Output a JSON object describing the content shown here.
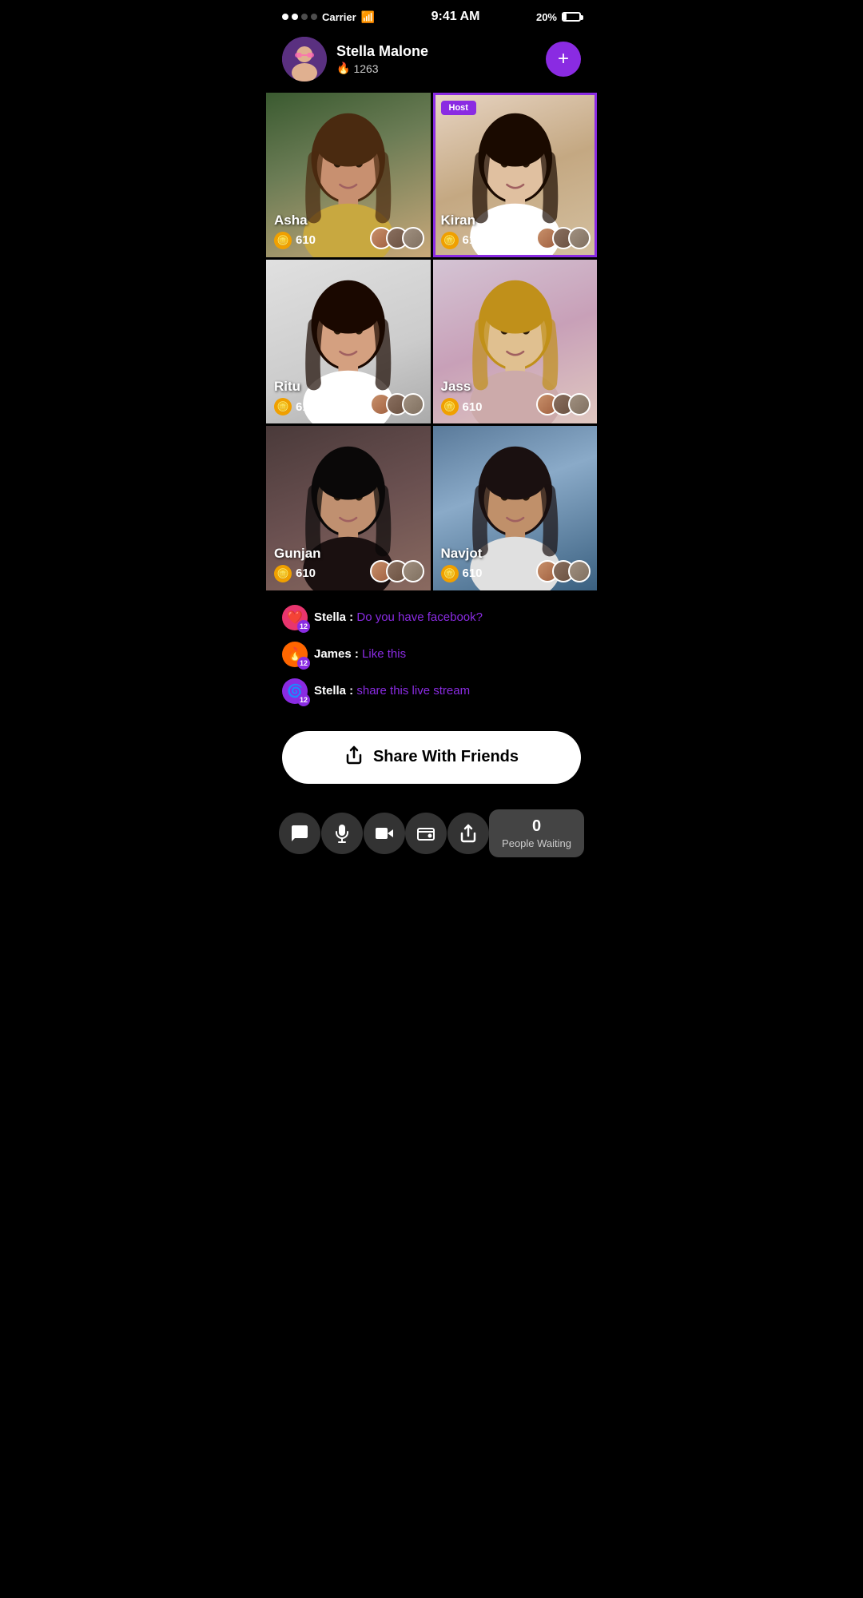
{
  "statusBar": {
    "carrier": "Carrier",
    "time": "9:41 AM",
    "battery": "20%"
  },
  "profile": {
    "name": "Stella Malone",
    "score": "1263",
    "addLabel": "+"
  },
  "videoGrid": [
    {
      "id": "asha",
      "name": "Asha",
      "coins": "610",
      "isHost": false,
      "bgClass": "bg-asha"
    },
    {
      "id": "kiran",
      "name": "Kiran",
      "coins": "610",
      "isHost": true,
      "hostLabel": "Host",
      "bgClass": "bg-kiran"
    },
    {
      "id": "ritu",
      "name": "Ritu",
      "coins": "610",
      "isHost": false,
      "bgClass": "bg-ritu"
    },
    {
      "id": "jass",
      "name": "Jass",
      "coins": "610",
      "isHost": false,
      "bgClass": "bg-jass"
    },
    {
      "id": "gunjan",
      "name": "Gunjan",
      "coins": "610",
      "isHost": false,
      "bgClass": "bg-gunjan"
    },
    {
      "id": "navjot",
      "name": "Navjot",
      "coins": "610",
      "isHost": false,
      "bgClass": "bg-navjot"
    }
  ],
  "chat": {
    "messages": [
      {
        "id": "msg1",
        "username": "Stella",
        "message": "Do you have facebook?",
        "avatarType": "heart",
        "badge": "12"
      },
      {
        "id": "msg2",
        "username": "James",
        "message": "Like this",
        "avatarType": "fire",
        "badge": "12"
      },
      {
        "id": "msg3",
        "username": "Stella",
        "message": "share this live stream",
        "avatarType": "purple",
        "badge": "12"
      }
    ]
  },
  "shareButton": {
    "label": "Share With Friends"
  },
  "bottomBar": {
    "buttons": [
      "chat",
      "mic",
      "video",
      "wallet",
      "share"
    ],
    "waitingCount": "0",
    "waitingLabel": "People Waiting"
  }
}
